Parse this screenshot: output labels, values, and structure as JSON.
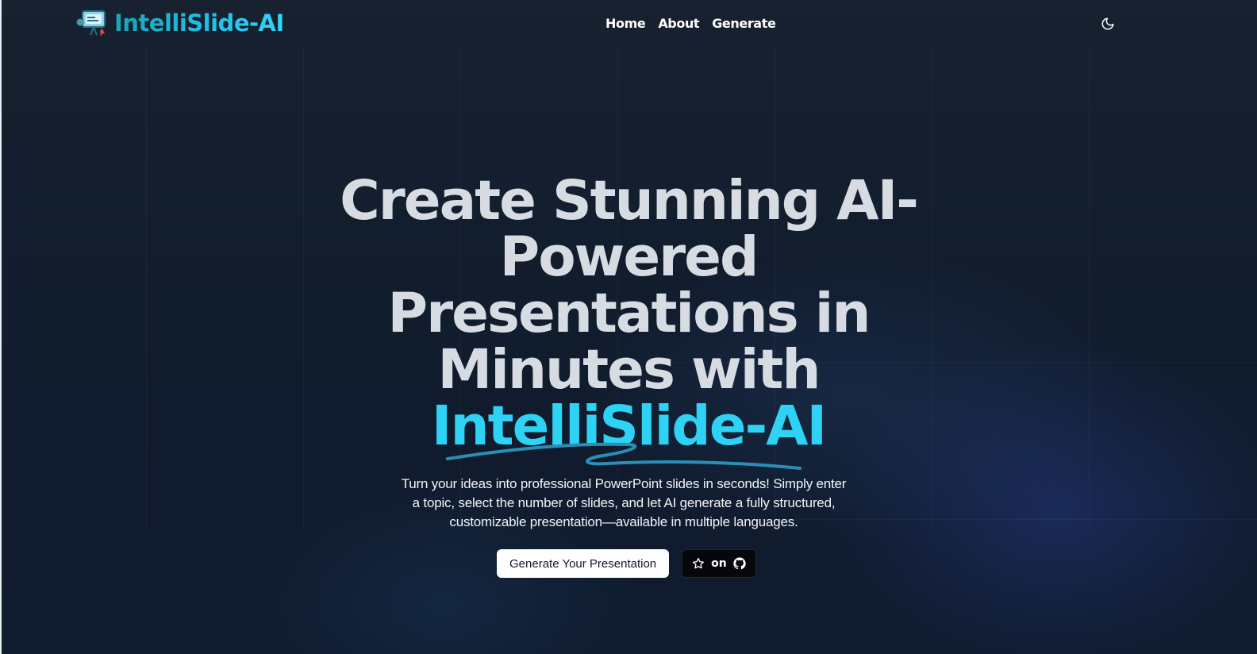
{
  "header": {
    "logo_text": "IntelliSlide-AI",
    "logo_icon": "presentation-robot-icon",
    "nav": [
      {
        "label": "Home"
      },
      {
        "label": "About"
      },
      {
        "label": "Generate"
      }
    ],
    "theme_toggle_icon": "moon-icon"
  },
  "hero": {
    "title_lines": [
      "Create Stunning AI-",
      "Powered",
      "Presentations in",
      "Minutes with"
    ],
    "title_brand": "IntelliSlide-AI",
    "description": "Turn your ideas into professional PowerPoint slides in seconds! Simply enter a topic, select the number of slides, and let AI generate a fully structured, customizable presentation—available in multiple languages.",
    "primary_cta": "Generate Your Presentation",
    "github_cta": {
      "label": "on",
      "leading_icon": "star-icon",
      "trailing_icon": "github-icon"
    }
  },
  "colors": {
    "brand_cyan": "#2ed2f4",
    "background": "#111c2d",
    "title_gray": "#d7dbe2"
  }
}
